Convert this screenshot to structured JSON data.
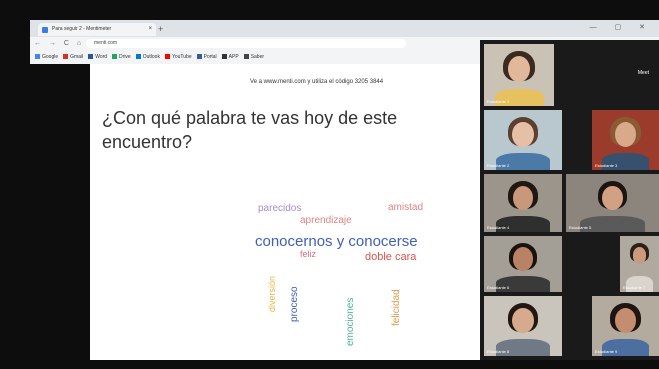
{
  "browser": {
    "tab_title": "Para seguir 2 - Mentimeter",
    "tab_close": "×",
    "new_tab": "+",
    "window_controls": "— ▢ ✕",
    "nav_glyphs": "← → C ⌂",
    "url": "menti.com",
    "bookmarks": [
      {
        "label": "Google",
        "color": "#4285f4"
      },
      {
        "label": "Gmail",
        "color": "#d93025"
      },
      {
        "label": "Word",
        "color": "#2b579a"
      },
      {
        "label": "Drive",
        "color": "#1fa463"
      },
      {
        "label": "Outlook",
        "color": "#0078d4"
      },
      {
        "label": "YouTube",
        "color": "#ff0000"
      },
      {
        "label": "Portal",
        "color": "#3b5998"
      },
      {
        "label": "APP",
        "color": "#333333"
      },
      {
        "label": "Saber",
        "color": "#444444"
      }
    ]
  },
  "slide": {
    "instruction": "Ve a www.menti.com y utiliza el código 3205 3844",
    "question": "¿Con qué palabra te vas hoy de este encuentro?",
    "words": [
      {
        "text": "parecidos",
        "color": "#a98bd0",
        "size": 10,
        "vertical": false
      },
      {
        "text": "aprendizaje",
        "color": "#e0847f",
        "size": 10,
        "vertical": false
      },
      {
        "text": "amistad",
        "color": "#e0847f",
        "size": 10,
        "vertical": false
      },
      {
        "text": "conocernos y conocerse",
        "color": "#3f5fb8",
        "size": 15,
        "vertical": false
      },
      {
        "text": "feliz",
        "color": "#e06b7a",
        "size": 9,
        "vertical": false
      },
      {
        "text": "doble cara",
        "color": "#d9534f",
        "size": 11,
        "vertical": false
      },
      {
        "text": "diversión",
        "color": "#e8b84a",
        "size": 9,
        "vertical": true
      },
      {
        "text": "proceso",
        "color": "#3f5fb8",
        "size": 10,
        "vertical": true
      },
      {
        "text": "emociones",
        "color": "#4fb39a",
        "size": 10,
        "vertical": true
      },
      {
        "text": "felicidad",
        "color": "#e39a4c",
        "size": 10,
        "vertical": true
      }
    ]
  },
  "meeting": {
    "label": "Meet",
    "participants": [
      {
        "name": "Estudiante 1",
        "skin": "#e2b89a",
        "hair": "#3a2a20",
        "shirt": "#e7c060",
        "bg": "#c9c2b5"
      },
      {
        "name": "Estudiante 2",
        "skin": "#e5c0a6",
        "hair": "#5a4030",
        "shirt": "#4c7aa8",
        "bg": "#b9c7cf"
      },
      {
        "name": "Estudiante 3",
        "skin": "#d9a98a",
        "hair": "#8b5a32",
        "shirt": "#36506e",
        "bg": "#9b3b2c"
      },
      {
        "name": "Estudiante 4",
        "skin": "#c99779",
        "hair": "#1f1812",
        "shirt": "#2f2f2f",
        "bg": "#9c958c"
      },
      {
        "name": "Estudiante 5",
        "skin": "#d2a184",
        "hair": "#1c1410",
        "shirt": "#5a5a5a",
        "bg": "#8b857d"
      },
      {
        "name": "Estudiante 6",
        "skin": "#b98266",
        "hair": "#1a120d",
        "shirt": "#3a3a3a",
        "bg": "#a39e96"
      },
      {
        "name": "Estudiante 7",
        "skin": "#c99a7e",
        "hair": "#2b1f17",
        "shirt": "#d9d4cc",
        "bg": "#b0a99f"
      },
      {
        "name": "Estudiante 8",
        "skin": "#d6aa8d",
        "hair": "#221812",
        "shirt": "#6f7a86",
        "bg": "#c9c4bc"
      },
      {
        "name": "Estudiante 9",
        "skin": "#c28d70",
        "hair": "#1e1510",
        "shirt": "#4c6ea0",
        "bg": "#b4ab9f"
      }
    ]
  }
}
